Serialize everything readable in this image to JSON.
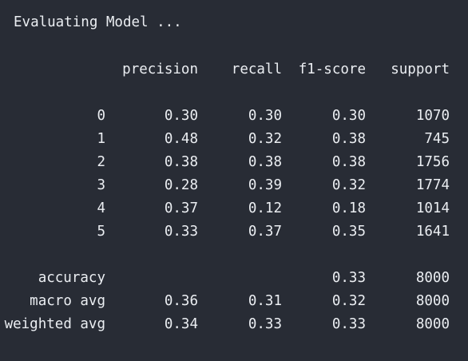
{
  "output": {
    "heading": "Evaluating Model ...",
    "columns": [
      "precision",
      "recall",
      "f1-score",
      "support"
    ],
    "class_rows": [
      {
        "label": "0",
        "precision": "0.30",
        "recall": "0.30",
        "f1": "0.30",
        "support": "1070"
      },
      {
        "label": "1",
        "precision": "0.48",
        "recall": "0.32",
        "f1": "0.38",
        "support": "745"
      },
      {
        "label": "2",
        "precision": "0.38",
        "recall": "0.38",
        "f1": "0.38",
        "support": "1756"
      },
      {
        "label": "3",
        "precision": "0.28",
        "recall": "0.39",
        "f1": "0.32",
        "support": "1774"
      },
      {
        "label": "4",
        "precision": "0.37",
        "recall": "0.12",
        "f1": "0.18",
        "support": "1014"
      },
      {
        "label": "5",
        "precision": "0.33",
        "recall": "0.37",
        "f1": "0.35",
        "support": "1641"
      }
    ],
    "summary_rows": [
      {
        "label": "accuracy",
        "precision": "",
        "recall": "",
        "f1": "0.33",
        "support": "8000"
      },
      {
        "label": "macro avg",
        "precision": "0.36",
        "recall": "0.31",
        "f1": "0.32",
        "support": "8000"
      },
      {
        "label": "weighted avg",
        "precision": "0.34",
        "recall": "0.33",
        "f1": "0.33",
        "support": "8000"
      }
    ]
  },
  "colors": {
    "background": "#282c35",
    "text": "#ebeef2"
  }
}
